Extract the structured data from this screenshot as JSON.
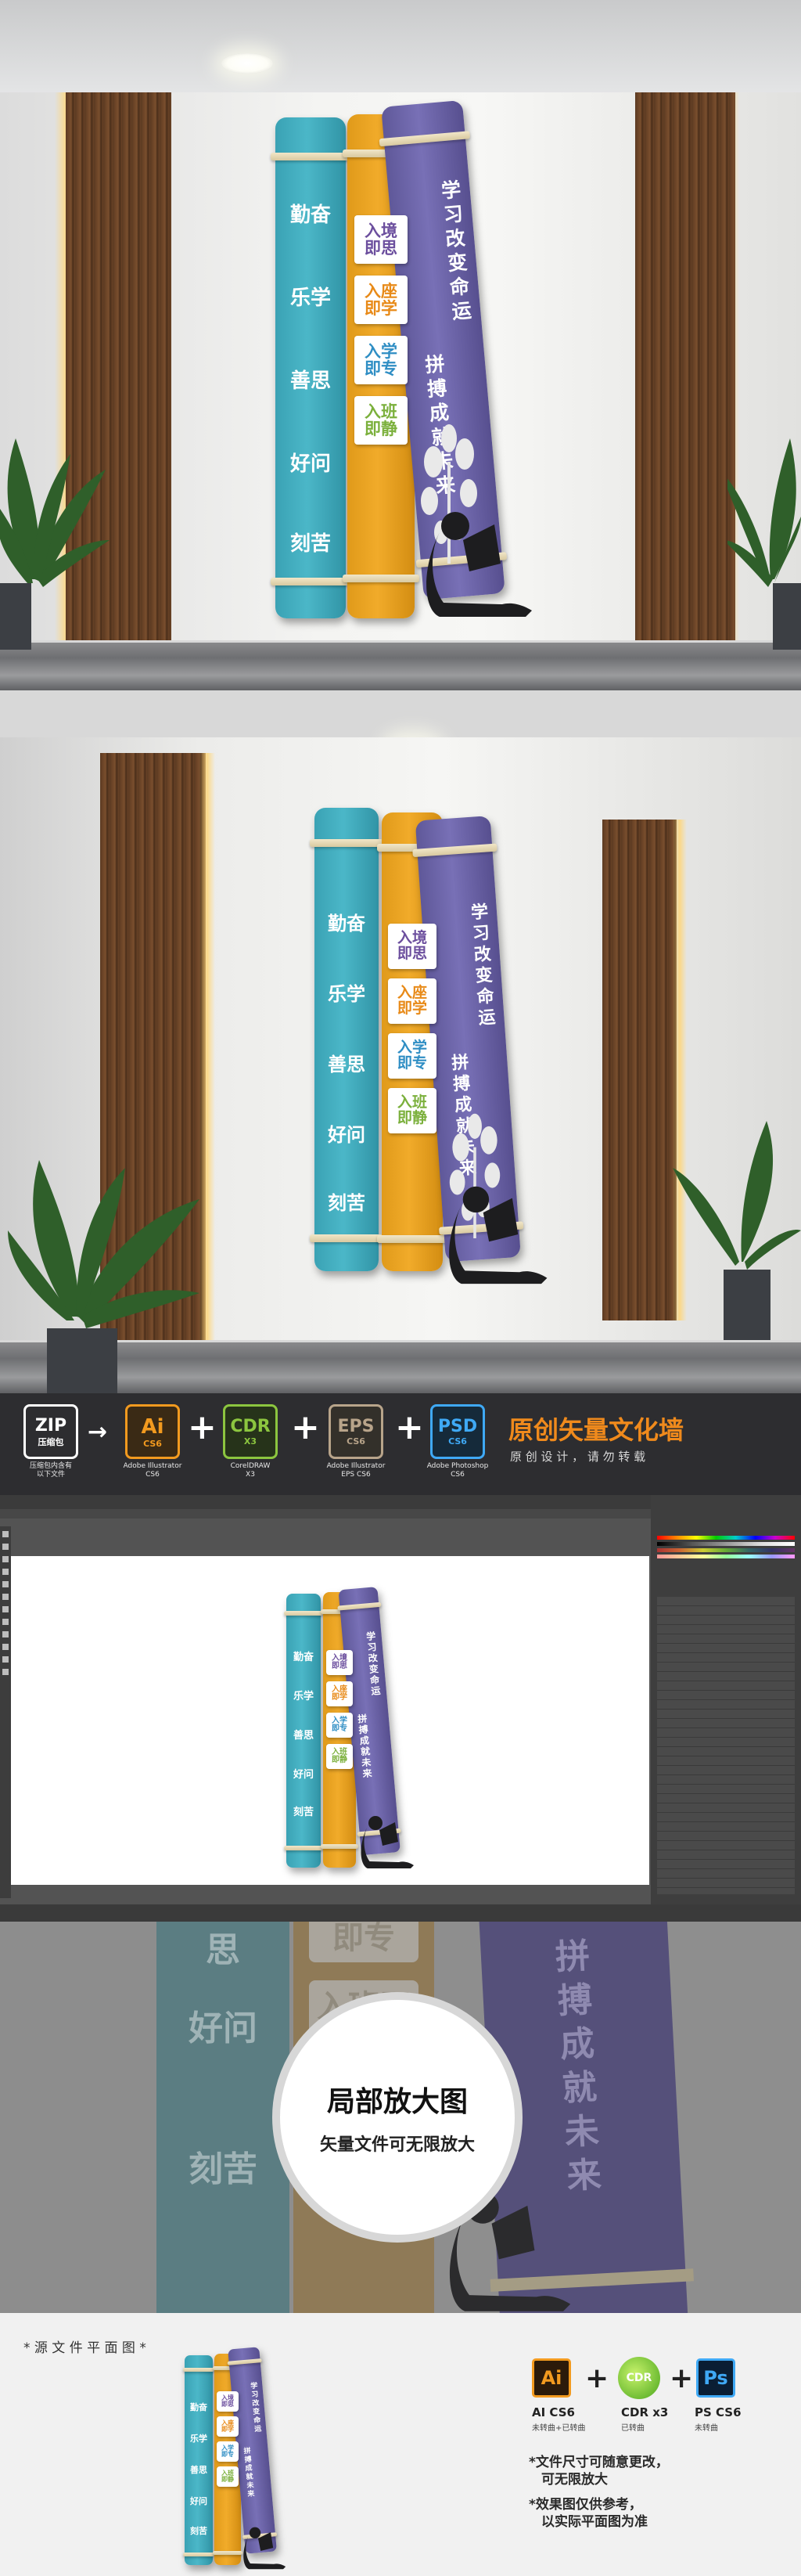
{
  "artwork": {
    "teal_text": "勤奋  乐学  善思  好问  刻苦",
    "teal_lines": [
      "勤奋",
      "乐学",
      "善思",
      "好问",
      "刻苦"
    ],
    "tags": [
      {
        "top": "入境",
        "bottom": "即思",
        "color": "#6c4f9e"
      },
      {
        "top": "入座",
        "bottom": "即学",
        "color": "#e88a18"
      },
      {
        "top": "入学",
        "bottom": "即专",
        "color": "#2f8ec4"
      },
      {
        "top": "入班",
        "bottom": "即静",
        "color": "#7bb03c"
      }
    ],
    "purple_line1": "学习改变命运",
    "purple_line2": "拼搏成就未来"
  },
  "formats": {
    "items": [
      {
        "badge": "ZIP",
        "sub": "压缩包",
        "caption": "压缩包内含有\n以下文件",
        "color": "#ffffff"
      },
      {
        "badge": "Ai",
        "sub": "CS6",
        "caption": "Adobe Illustrator\nCS6",
        "color": "#f29a1f"
      },
      {
        "badge": "CDR",
        "sub": "X3",
        "caption": "CorelDRAW\nX3",
        "color": "#8cc63f"
      },
      {
        "badge": "EPS",
        "sub": "CS6",
        "caption": "Adobe Illustrator\nEPS CS6",
        "color": "#b8a48a"
      },
      {
        "badge": "PSD",
        "sub": "CS6",
        "caption": "Adobe Photoshop\nCS6",
        "color": "#3fa9f5"
      }
    ],
    "headline": "原创矢量文化墙",
    "subline": "原 创 设 计 ， 请 勿 转 载"
  },
  "zoom": {
    "title": "局部放大图",
    "subtitle": "矢量文件可无限放大",
    "bg_left_texts": [
      "思",
      "好问",
      "刻苦"
    ],
    "bg_right_text": "拼搏成就未来",
    "bg_tags": [
      "即专",
      "入班即静"
    ]
  },
  "source": {
    "label": "* 源 文 件 平 面 图 *",
    "software": [
      {
        "icon": "Ai",
        "name": "AI CS6",
        "note": "未转曲+已转曲"
      },
      {
        "icon": "CDR",
        "name": "CDR x3",
        "note": "已转曲"
      },
      {
        "icon": "Ps",
        "name": "PS CS6",
        "note": "未转曲"
      }
    ],
    "notes": [
      "*文件尺寸可随意更改，",
      "可无限放大",
      "*效果图仅供参考，",
      "以实际平面图为准"
    ]
  },
  "colors": {
    "teal": "#45b1c3",
    "orange": "#eea42a",
    "purple": "#6f68ad",
    "headline_orange": "#f08a1c"
  }
}
